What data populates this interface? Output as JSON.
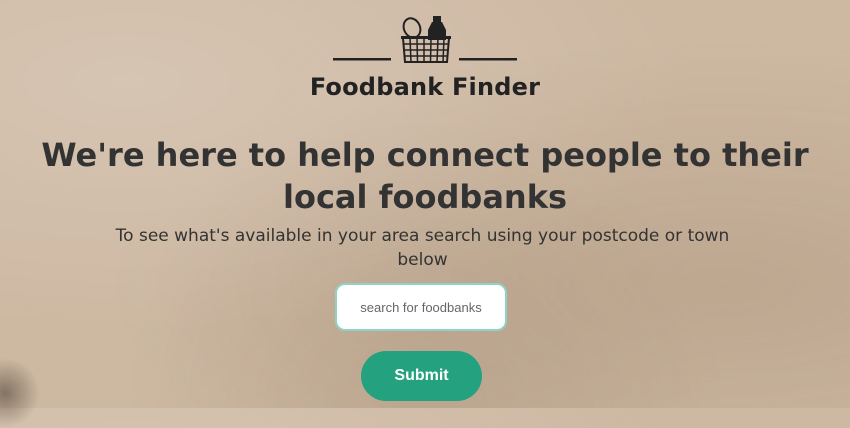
{
  "brand": {
    "name": "Foodbank Finder",
    "logo_icon": "basket-icon"
  },
  "hero": {
    "headline": "We're here to help connect people to their local foodbanks",
    "subtext": "To see what's available in your area search using your postcode or town below"
  },
  "search": {
    "placeholder": "search for foodbanks",
    "value": "",
    "submit_label": "Submit"
  },
  "colors": {
    "background": "#cdb8a2",
    "accent": "#24a17e",
    "input_border": "#8ed3c5",
    "text": "#333333"
  }
}
